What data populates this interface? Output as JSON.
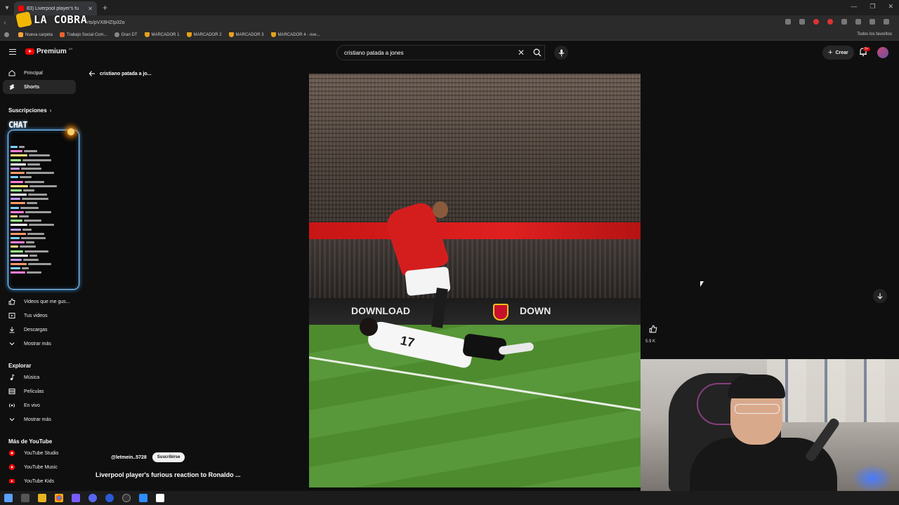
{
  "browser": {
    "tab_title": "83) Liverpool player's fu",
    "url_fragment": "rts/pVX8HZIp32o",
    "bookmarks": [
      "Nueva carpeta",
      "Trabajo Social Com...",
      "Gran DT",
      "MARCADOR 1",
      "MARCADOR 2",
      "MARCADOR 3",
      "MARCADOR 4 - ove..."
    ],
    "all_bookmarks": "Todos los favoritos"
  },
  "overlay": {
    "logo_text": "LA COBRA",
    "chat_title": "CHAT"
  },
  "header": {
    "logo_word": "Premium",
    "logo_region": "AR",
    "search_value": "cristiano patada a jones",
    "create_label": "Crear",
    "notifications_badge": "9+"
  },
  "sidebar": {
    "items": [
      {
        "label": "Principal",
        "icon": "home-icon"
      },
      {
        "label": "Shorts",
        "icon": "shorts-icon"
      }
    ],
    "subscriptions_label": "Suscripciones",
    "you_items": [
      {
        "label": "Videos que me gus...",
        "icon": "like-icon"
      },
      {
        "label": "Tus videos",
        "icon": "video-icon"
      },
      {
        "label": "Descargas",
        "icon": "download-icon"
      },
      {
        "label": "Mostrar más",
        "icon": "chevron-down-icon"
      }
    ],
    "explore_label": "Explorar",
    "explore_items": [
      {
        "label": "Música",
        "icon": "music-icon"
      },
      {
        "label": "Películas",
        "icon": "film-icon"
      },
      {
        "label": "En vivo",
        "icon": "live-icon"
      },
      {
        "label": "Mostrar más",
        "icon": "chevron-down-icon"
      }
    ],
    "more_label": "Más de YouTube",
    "more_items": [
      {
        "label": "YouTube Studio"
      },
      {
        "label": "YouTube Music"
      },
      {
        "label": "YouTube Kids"
      }
    ]
  },
  "main": {
    "back_label": "cristiano patada a jo...",
    "channel_handle": "@letmein..5728",
    "subscribe_label": "Suscribirse",
    "video_title": "Liverpool player's furious reaction to Ronaldo ...",
    "like_count": "5.9 K",
    "board_text_left": "DOWNLOAD",
    "board_text_right": "DOWN",
    "jersey_number": "17"
  },
  "colors": {
    "background": "#0f0f0f",
    "youtube_red": "#ff0000",
    "chat_border": "#8fd3ff"
  }
}
